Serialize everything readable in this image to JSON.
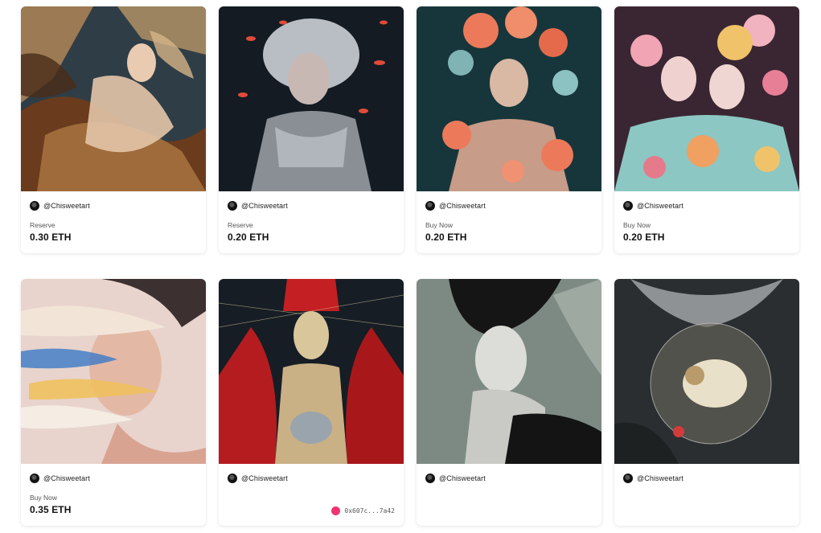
{
  "cards": [
    {
      "creator": "@Chisweetart",
      "status": "Reserve",
      "price": "0.30 ETH",
      "palette": [
        "#3a4a55",
        "#b88956",
        "#e6cfa9",
        "#5b3a1f"
      ]
    },
    {
      "creator": "@Chisweetart",
      "status": "Reserve",
      "price": "0.20 ETH",
      "palette": [
        "#151c24",
        "#c9ced6",
        "#e04a3a",
        "#6b7682"
      ]
    },
    {
      "creator": "@Chisweetart",
      "status": "Buy Now",
      "price": "0.20 ETH",
      "palette": [
        "#1c3d42",
        "#ec7a5a",
        "#7fb3b4",
        "#d9b8a4"
      ]
    },
    {
      "creator": "@Chisweetart",
      "status": "Buy Now",
      "price": "0.20 ETH",
      "palette": [
        "#3a2632",
        "#f0a4b4",
        "#8cc7c3",
        "#f0c36a"
      ]
    },
    {
      "creator": "@Chisweetart",
      "status": "Buy Now",
      "price": "0.35 ETH",
      "palette": [
        "#e8d4cc",
        "#3b79c7",
        "#f0c058",
        "#d9a392"
      ]
    },
    {
      "creator": "@Chisweetart",
      "status": "",
      "price": "",
      "owner": "0x607c...7a42",
      "palette": [
        "#182028",
        "#c41f22",
        "#d9c69a",
        "#7a5b3a"
      ]
    },
    {
      "creator": "@Chisweetart",
      "status": "",
      "price": "",
      "palette": [
        "#7d8a84",
        "#dcdcd8",
        "#151515",
        "#a6b0aa"
      ]
    },
    {
      "creator": "@Chisweetart",
      "status": "",
      "price": "",
      "palette": [
        "#2a2e30",
        "#c9c9c6",
        "#7b6a55",
        "#e8e0c8"
      ]
    }
  ]
}
